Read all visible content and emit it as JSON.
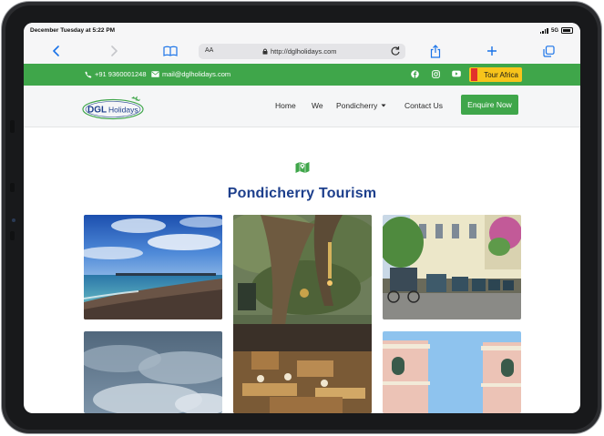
{
  "status_bar": {
    "datetime": "December Tuesday at 5:22 PM",
    "network": "5G"
  },
  "safari": {
    "text_size_label": "AA",
    "url": "http://dglholidays.com"
  },
  "topbar": {
    "phone": "+91 9360001248",
    "email": "mail@dglholidays.com",
    "tour_button": "Tour Africa",
    "color": "#3fa64a"
  },
  "navbar": {
    "logo_text": "DGL Holidays",
    "items": [
      {
        "label": "Home"
      },
      {
        "label": "We"
      },
      {
        "label": "Pondicherry"
      },
      {
        "label": "Contact Us"
      }
    ],
    "enquire_label": "Enquire Now"
  },
  "main": {
    "title": "Pondicherry Tourism",
    "title_color": "#1d3f8c"
  },
  "icons": [
    "back-icon",
    "forward-icon",
    "book-icon",
    "lock-icon",
    "reload-icon",
    "share-icon",
    "plus-icon",
    "tabs-icon",
    "phone-icon",
    "mail-icon",
    "facebook-icon",
    "instagram-icon",
    "youtube-icon",
    "map-icon",
    "chevron-down-icon"
  ]
}
